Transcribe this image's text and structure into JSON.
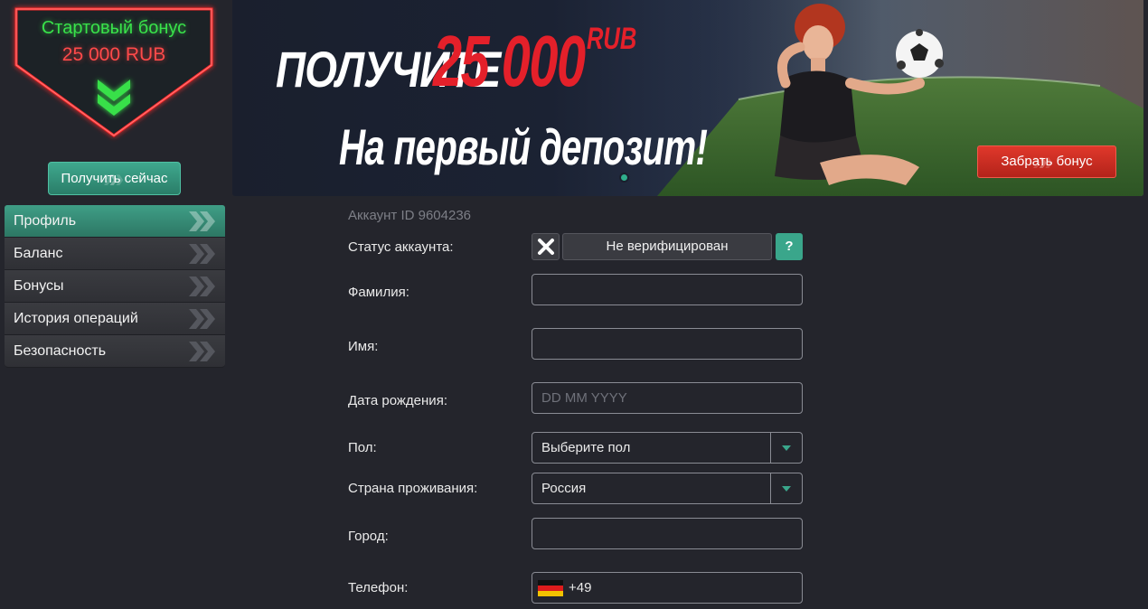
{
  "promo": {
    "title": "Стартовый бонус",
    "amount": "25 000 RUB",
    "cta_label": "Получить сейчас"
  },
  "sidebar": {
    "items": [
      {
        "label": "Профиль",
        "active": true
      },
      {
        "label": "Баланс",
        "active": false
      },
      {
        "label": "Бонусы",
        "active": false
      },
      {
        "label": "История операций",
        "active": false
      },
      {
        "label": "Безопасность",
        "active": false
      }
    ]
  },
  "banner": {
    "line1": "ПОЛУЧИТЕ",
    "amount": "25 000",
    "currency": "RUB",
    "line2": "На первый депозит!",
    "claim_label": "Забрать бонус"
  },
  "account": {
    "id_text": "Аккаунт ID 9604236"
  },
  "form": {
    "status": {
      "label": "Статус аккаунта:",
      "value": "Не верифицирован",
      "help": "?"
    },
    "surname": {
      "label": "Фамилия:",
      "value": ""
    },
    "first_name": {
      "label": "Имя:",
      "value": ""
    },
    "birth_date": {
      "label": "Дата рождения:",
      "value": "",
      "placeholder": "DD MM YYYY"
    },
    "gender": {
      "label": "Пол:",
      "value": "Выберите пол"
    },
    "country": {
      "label": "Страна проживания:",
      "value": "Россия"
    },
    "city": {
      "label": "Город:",
      "value": ""
    },
    "phone": {
      "label": "Телефон:",
      "code": "+49"
    }
  },
  "colors": {
    "accent": "#3aa68b",
    "danger": "#e0382b",
    "background": "#24252c"
  }
}
